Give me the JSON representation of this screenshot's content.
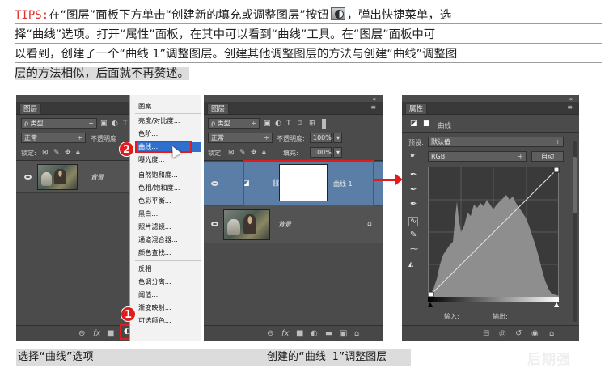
{
  "tip": {
    "label": "TIPS:",
    "line1_a": "在“图层”面板下方单击“创建新的填充或调整图层”按钮",
    "line1_b": "，弹出快捷菜单，选",
    "line2": "择“曲线”选项。打开“属性”面板，在其中可以看到“曲线”工具。在“图层”面板中可",
    "line3": "以看到，创建了一个“曲线 1”调整图层。创建其他调整图层的方法与创建“曲线”调整图",
    "line4": "层的方法相似，后面就不再赘述。"
  },
  "shot1": {
    "panel_tab": "图层",
    "filter_label": "ρ 类型",
    "blend_mode": "正常",
    "opacity_label": "不透明度",
    "lock_label": "锁定:",
    "layer_name": "背景",
    "menu_items": [
      "图案...",
      "亮度/对比度...",
      "色阶...",
      "曲线...",
      "曝光度...",
      "自然饱和度...",
      "色相/饱和度...",
      "色彩平衡...",
      "黑白...",
      "照片滤镜...",
      "通道混合器...",
      "颜色查找...",
      "反相",
      "色调分离...",
      "阈值...",
      "渐变映射...",
      "可选颜色..."
    ],
    "badge_menu": "2",
    "badge_button": "1"
  },
  "shot2": {
    "panel_tab": "图层",
    "filter_label": "ρ 类型",
    "blend_mode": "正常",
    "opacity_label": "不透明度:",
    "opacity_value": "100%",
    "lock_label": "锁定:",
    "fill_label": "填充:",
    "fill_value": "100%",
    "adj_layer_name": "曲线 1",
    "bg_layer_name": "背景"
  },
  "shot3": {
    "panel_tab": "属性",
    "header_label": "曲线",
    "preset_label": "预设:",
    "preset_value": "默认值",
    "channel_value": "RGB",
    "auto_button": "自动",
    "input_label": "输入:",
    "output_label": "输出:"
  },
  "captions": {
    "left": "选择“曲线”选项",
    "right": "创建的“曲线 1”调整图层"
  },
  "watermark": "后期强"
}
